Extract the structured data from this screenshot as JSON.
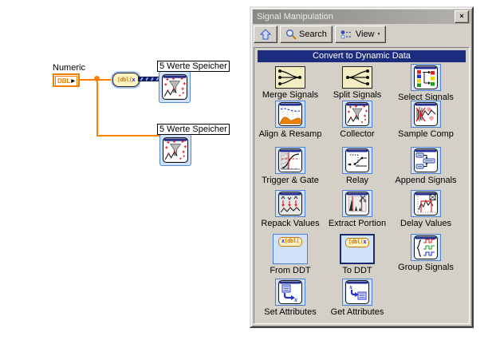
{
  "diagram": {
    "numeric_label": "Numeric",
    "terminal_text": "DBL",
    "terminal_arrow": "▶",
    "convert_glyph_left": "[dbl(",
    "convert_glyph_right": "x",
    "subvi1_label": "5 Werte Speicher",
    "subvi2_label": "5 Werte Speicher"
  },
  "palette": {
    "title": "Signal Manipulation",
    "close": "×",
    "toolbar": {
      "search": "Search",
      "view": "View",
      "view_arrow": "▼"
    },
    "header": "Convert to Dynamic Data",
    "glyphs": {
      "from_ddt_left": "x",
      "from_ddt_right": "[dbl(",
      "to_ddt_left": "[dbl(",
      "to_ddt_right": "x"
    },
    "items": [
      {
        "label": "Merge Signals"
      },
      {
        "label": "Split Signals"
      },
      {
        "label": "Select Signals"
      },
      {
        "label": "Align & Resamp"
      },
      {
        "label": "Collector"
      },
      {
        "label": "Sample Comp"
      },
      {
        "label": "Trigger & Gate"
      },
      {
        "label": "Relay"
      },
      {
        "label": "Append Signals"
      },
      {
        "label": "Repack Values"
      },
      {
        "label": "Extract Portion"
      },
      {
        "label": "Delay Values"
      },
      {
        "label": "From DDT"
      },
      {
        "label": "To DDT"
      },
      {
        "label": "Group Signals"
      },
      {
        "label": "Set Attributes"
      },
      {
        "label": "Get Attributes"
      }
    ],
    "colors": {
      "header_bg": "#1c2d80",
      "express_border": "#4a7fd4",
      "wire_orange": "#ff8000",
      "dynamic_wire_navy": "#121f6b"
    }
  }
}
